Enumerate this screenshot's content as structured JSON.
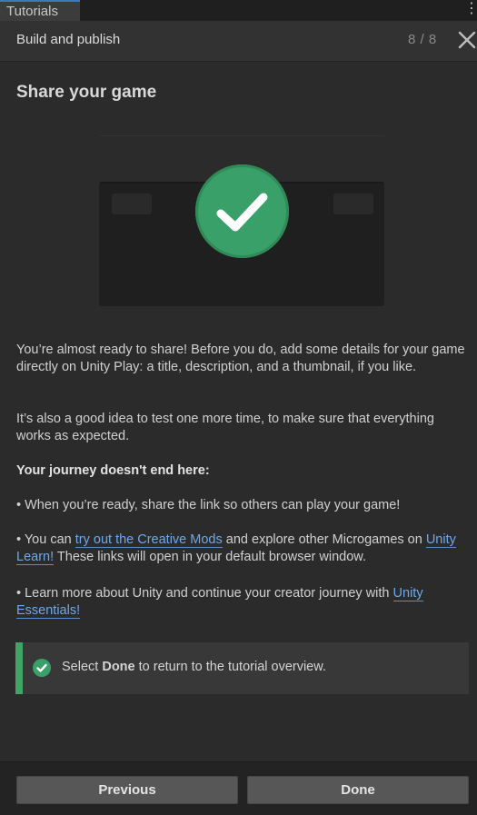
{
  "tabbar": {
    "tab_label": "Tutorials",
    "menu_icon": "kebab-menu-icon"
  },
  "header": {
    "title": "Build and publish",
    "step": "8 / 8",
    "close_icon": "close-icon"
  },
  "main": {
    "title": "Share your game",
    "illustration": {
      "icon": "checkmark-circle-icon",
      "accent": "#3aa06a"
    },
    "paragraphs": {
      "p1": "You’re almost ready to share! Before you do, add some details for your game directly on Unity Play: a title, description, and a thumbnail, if you like.",
      "p2": "It’s also a good idea to test one more time, to make sure that everything works as expected.",
      "journey_heading": "Your journey doesn't end here:",
      "bullet1": "• When you’re ready, share the link so others can play your game!",
      "bullet2_pre": "• You can ",
      "bullet2_link1": "try out the Creative Mods",
      "bullet2_mid": " and explore other Microgames on ",
      "bullet2_link2": "Unity Learn!",
      "bullet2_post": " These links will open in your default browser window.",
      "bullet3_pre": "• Learn more about Unity and continue your creator journey with ",
      "bullet3_link": "Unity Essentials!"
    },
    "callout": {
      "icon": "checkmark-circle-icon",
      "pre": "Select ",
      "bold": "Done",
      "post": " to return to the tutorial overview.",
      "accent": "#3fa564"
    }
  },
  "footer": {
    "previous_label": "Previous",
    "done_label": "Done"
  },
  "colors": {
    "link": "#6fa8e8",
    "tab_accent": "#3a79bb"
  }
}
